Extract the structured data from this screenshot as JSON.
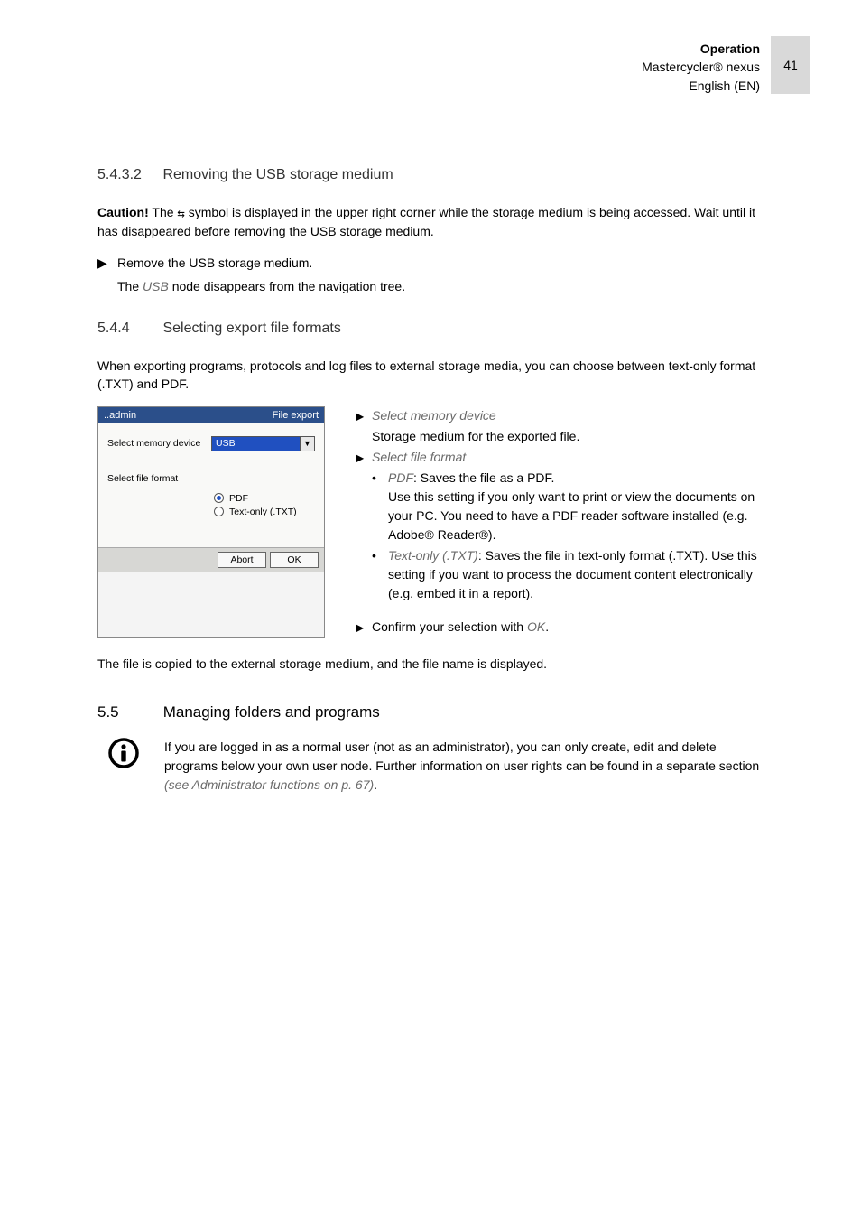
{
  "header": {
    "section": "Operation",
    "product": "Mastercycler® nexus",
    "lang": "English (EN)",
    "page_number": "41"
  },
  "s1": {
    "num": "5.4.3.2",
    "title": "Removing the USB storage medium",
    "caution_label": "Caution!",
    "caution_rest_a": " The ",
    "caution_glyph": "⇆",
    "caution_rest_b": " symbol is displayed in the upper right corner while the storage medium is being accessed. Wait until it has disappeared before removing the USB storage medium.",
    "bullet": "Remove the USB storage medium.",
    "sub_a": "The ",
    "sub_usb": "USB",
    "sub_b": " node disappears from the navigation tree."
  },
  "s2": {
    "num": "5.4.4",
    "title": "Selecting export file formats",
    "intro": "When exporting programs, protocols and log files to external storage media, you can choose between text-only format (.TXT) and PDF."
  },
  "screenshot": {
    "title_left": "..admin",
    "title_right": "File export",
    "label_device": "Select memory device",
    "select_value": "USB",
    "label_format": "Select file format",
    "radio_pdf": "PDF",
    "radio_txt": "Text-only (.TXT)",
    "btn_abort": "Abort",
    "btn_ok": "OK"
  },
  "explain": {
    "sel_mem": "Select memory device",
    "sel_mem_sub": "Storage medium for the exported file.",
    "sel_fmt": "Select file format",
    "pdf_head": "PDF",
    "pdf_rest": ": Saves the file as a PDF.",
    "pdf_sub": "Use this setting if you only want to print or view the documents on your PC. You need to have a PDF reader software installed (e.g. Adobe® Reader®).",
    "txt_head": "Text-only (.TXT)",
    "txt_rest": ": Saves the file in text-only format (.TXT). Use this setting if you want to process the document content electronically (e.g. embed it in a report).",
    "confirm_a": "Confirm your selection with ",
    "confirm_ok": "OK",
    "confirm_b": "."
  },
  "after": "The file is copied to the external storage medium, and the file name is displayed.",
  "s3": {
    "num": "5.5",
    "title": "Managing folders and programs",
    "info_a": "If you are logged in as a normal user (not as an administrator), you can only create, edit and delete programs below your own user node. Further information on user rights can be found in a separate section ",
    "info_ref": "(see Administrator functions on p. 67)",
    "info_b": "."
  }
}
